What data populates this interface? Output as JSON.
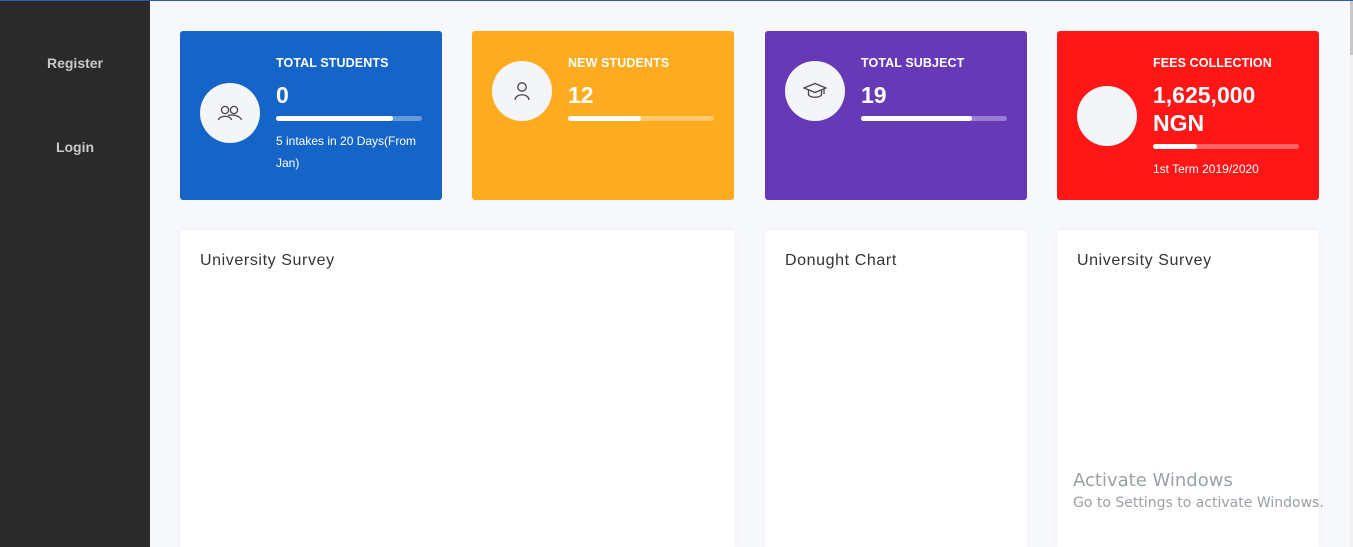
{
  "sidebar": {
    "items": [
      {
        "label": "Register"
      },
      {
        "label": "Login"
      }
    ]
  },
  "cards": [
    {
      "title": "TOTAL STUDENTS",
      "value": "0",
      "note": "5 intakes in 20 Days(From Jan)",
      "progress": 0.8,
      "color": "#1565c8",
      "icon": "users-icon"
    },
    {
      "title": "NEW STUDENTS",
      "value": "12",
      "progress": 0.5,
      "color": "#ffab1f",
      "icon": "user-icon"
    },
    {
      "title": "TOTAL SUBJECT",
      "value": "19",
      "progress": 0.76,
      "color": "#663ab6",
      "icon": "graduation-cap-icon"
    },
    {
      "title": "FEES COLLECTION",
      "value": "1,625,000 NGN",
      "note": "1st Term 2019/2020",
      "progress": 0.3,
      "color": "#ff1616",
      "icon": "blank-circle"
    }
  ],
  "panels": [
    {
      "title": "University Survey"
    },
    {
      "title": "Donught Chart"
    },
    {
      "title": "University Survey"
    }
  ],
  "watermark": {
    "line1": "Activate Windows",
    "line2": "Go to Settings to activate Windows."
  }
}
